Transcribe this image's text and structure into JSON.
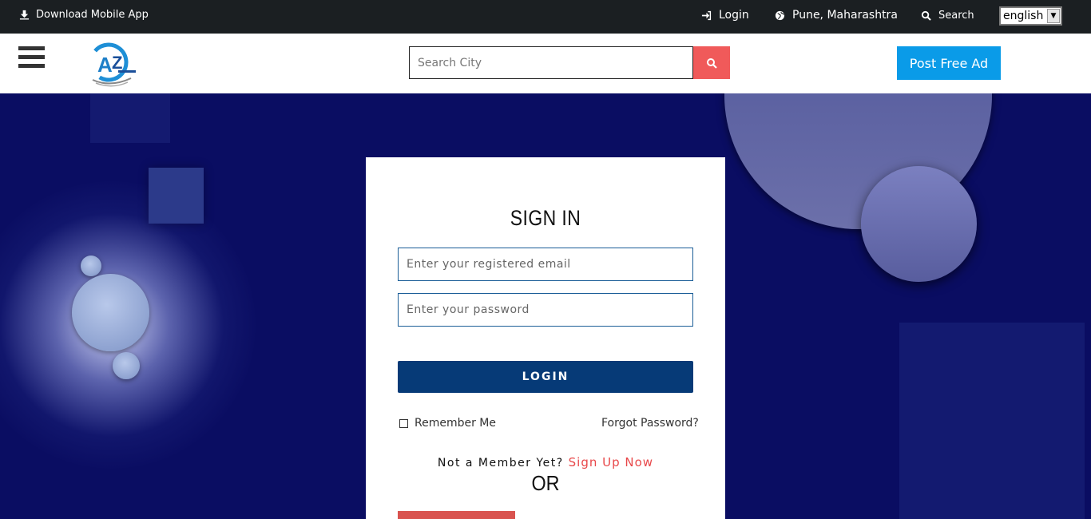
{
  "topbar": {
    "download_label": "Download Mobile App",
    "login_label": "Login",
    "location_label": "Pune, Maharashtra",
    "search_label": "Search",
    "language_selected": "english"
  },
  "header": {
    "search_placeholder": "Search City",
    "post_ad_label": "Post Free Ad"
  },
  "signin": {
    "title": "SIGN IN",
    "email_placeholder": "Enter your registered email",
    "password_placeholder": "Enter your password",
    "login_label": "LOGIN",
    "remember_label": "Remember Me",
    "forgot_label": "Forgot Password?",
    "member_prompt": "Not a Member Yet?",
    "signup_label": "Sign Up Now",
    "or_label": "OR"
  },
  "colors": {
    "topbar_bg": "#1b1f22",
    "page_bg": "#0a0d62",
    "accent_red": "#f05a5a",
    "post_ad_blue": "#0a9be8",
    "login_navy": "#063a77"
  }
}
